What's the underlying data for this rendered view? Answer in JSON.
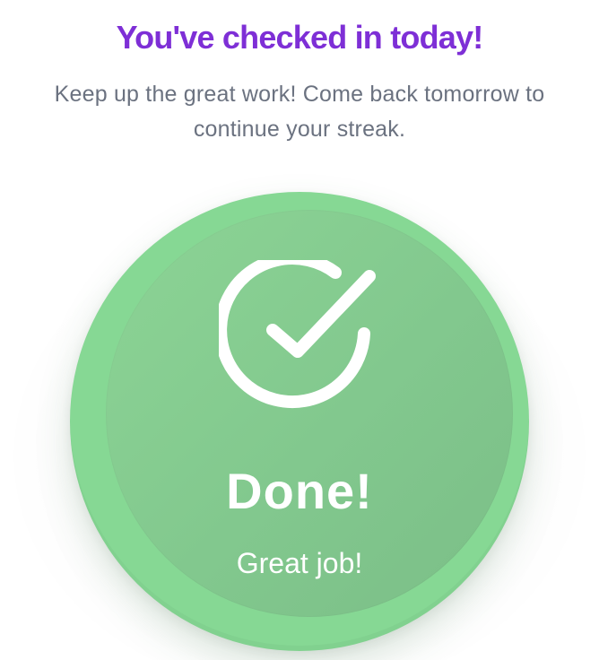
{
  "header": {
    "title": "You've checked in today!",
    "subtitle": "Keep up the great work! Come back tomorrow to continue your streak."
  },
  "done_button": {
    "icon": "check-circle-icon",
    "label": "Done!",
    "sublabel": "Great job!"
  },
  "colors": {
    "title": "#7e2fd6",
    "subtitle": "#6b7280",
    "button_outer": "#86d894",
    "button_inner": "#82c88e",
    "button_text": "#ffffff"
  }
}
